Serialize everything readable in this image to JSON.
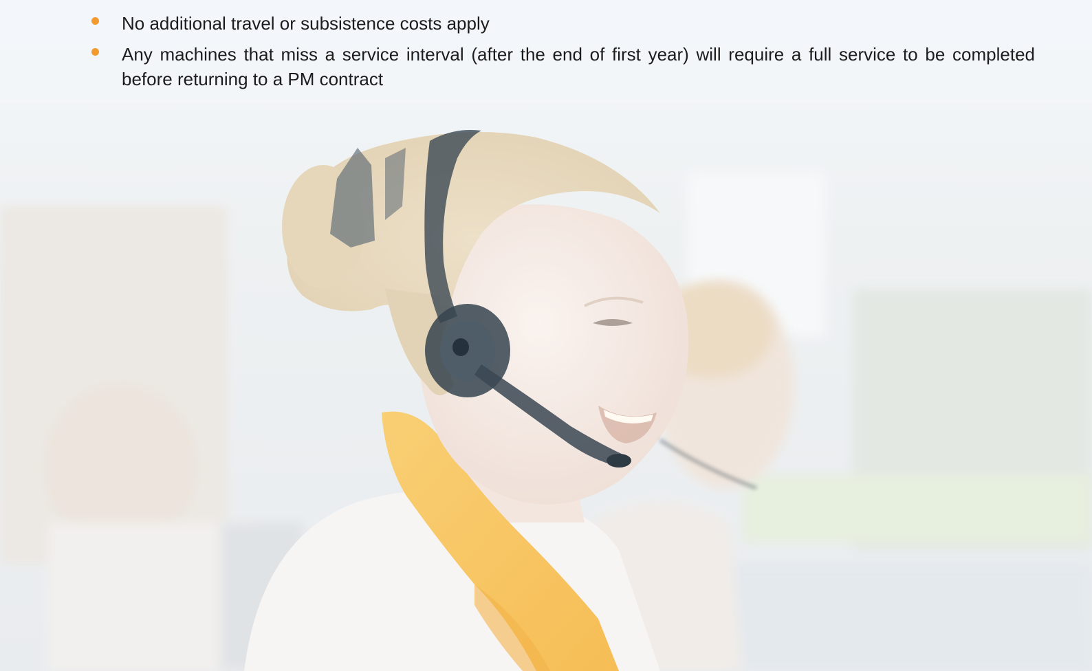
{
  "slide": {
    "background_description_icon": "photo-woman-headset",
    "bullet_color": "#f39a2e",
    "text_color": "#1c1c1c",
    "bullets": [
      {
        "text": "No additional travel or subsistence costs apply"
      },
      {
        "text": "Any machines that miss a service interval (after the end of first year) will require a full service to be completed before returning to a PM contract"
      }
    ]
  }
}
